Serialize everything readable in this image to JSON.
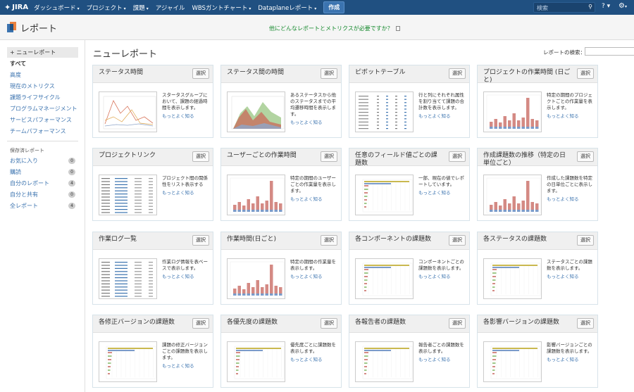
{
  "topbar": {
    "logo": "JIRA",
    "nav": [
      {
        "label": "ダッシュボード",
        "caret": "▾"
      },
      {
        "label": "プロジェクト",
        "caret": "▾"
      },
      {
        "label": "課題",
        "caret": "▾"
      },
      {
        "label": "アジャイル",
        "caret": ""
      },
      {
        "label": "WBSガントチャート",
        "caret": "▾"
      },
      {
        "label": "Dataplaneレポート",
        "caret": "▾"
      }
    ],
    "create_label": "作成",
    "search_placeholder": "検索",
    "help_glyph": "?",
    "settings_glyph": "⚙"
  },
  "header": {
    "title": "レポート",
    "link": "他にどんなレポートとメトリクスが必要ですか？"
  },
  "sidebar": {
    "new_report": "ニューレポート",
    "items": [
      {
        "label": "すべて",
        "active": true
      },
      {
        "label": "高度",
        "active": false
      },
      {
        "label": "現在のメトリクス",
        "active": false
      },
      {
        "label": "課題ライフサイクル",
        "active": false
      },
      {
        "label": "プログラムマネージメント",
        "active": false
      },
      {
        "label": "サービスパフォーマンス",
        "active": false
      },
      {
        "label": "チームパフォーマンス",
        "active": false
      }
    ],
    "saved_title": "保存済レポート",
    "saved": [
      {
        "label": "お気に入り",
        "count": "0"
      },
      {
        "label": "購読",
        "count": "0"
      },
      {
        "label": "自分のレポート",
        "count": "4"
      },
      {
        "label": "自分と共有",
        "count": "0"
      },
      {
        "label": "全レポート",
        "count": "4"
      }
    ]
  },
  "main": {
    "title": "ニューレポート",
    "search_label": "レポートの検索：",
    "select_label": "選択",
    "more_label": "もっとよく知る",
    "cards": [
      {
        "title": "ステータス時間",
        "desc": "スタータスグループにおいて、課題の経過時間を表示します。",
        "thumb": "line"
      },
      {
        "title": "ステータス間の時間",
        "desc": "あるステータスから他のステータスまでの平均遷移時間を表示します。",
        "thumb": "area"
      },
      {
        "title": "ピボットテーブル",
        "desc": "行と列にそれぞれ属性を割り当てて課題の合計数を表示します。",
        "thumb": "table"
      },
      {
        "title": "プロジェクトの作業時間 (日ごと)",
        "desc": "特定の期間のプロジェクトごとの作業量を表示します。",
        "thumb": "bars"
      },
      {
        "title": "プロジェクトリンク",
        "desc": "プロジェクト間の関係性をリスト表示する",
        "thumb": "list"
      },
      {
        "title": "ユーザーごとの作業時間",
        "desc": "特定の期間のユーザーごとの作業量を表示します。",
        "thumb": "bars"
      },
      {
        "title": "任意のフィールド値ごとの課題数",
        "desc": "一部、現在の値でレポートしています。",
        "thumb": "hbars"
      },
      {
        "title": "作成課題数の推移（特定の日単位ごと）",
        "desc": "作成した課題数を特定の日単位ごとに表示します。",
        "thumb": "bars"
      },
      {
        "title": "作業ログ一覧",
        "desc": "作業ログ情報を表ベースで表示します。",
        "thumb": "list"
      },
      {
        "title": "作業時間(日ごと)",
        "desc": "特定の期間の作業量を表示します。",
        "thumb": "bars"
      },
      {
        "title": "各コンポーネントの課題数",
        "desc": "コンポーネントごとの課題数を表示します。",
        "thumb": "hbars"
      },
      {
        "title": "各ステータスの課題数",
        "desc": "ステータスごとの課題数を表示します。",
        "thumb": "hbars"
      },
      {
        "title": "各修正バージョンの課題数",
        "desc": "課題の修正バージョンごとの課題数を表示します。",
        "thumb": "hbars"
      },
      {
        "title": "各優先度の課題数",
        "desc": "優先度ごとに課題数を表示します。",
        "thumb": "hbars"
      },
      {
        "title": "各報告者の課題数",
        "desc": "報告者ごとの課題数を表示します。",
        "thumb": "hbars"
      },
      {
        "title": "各影響バージョンの課題数",
        "desc": "影響バージョンごとの課題数を表示します。",
        "thumb": "hbars"
      }
    ]
  },
  "colors": {
    "topbar": "#205081",
    "link": "#3b73af",
    "green_link": "#14892c"
  }
}
